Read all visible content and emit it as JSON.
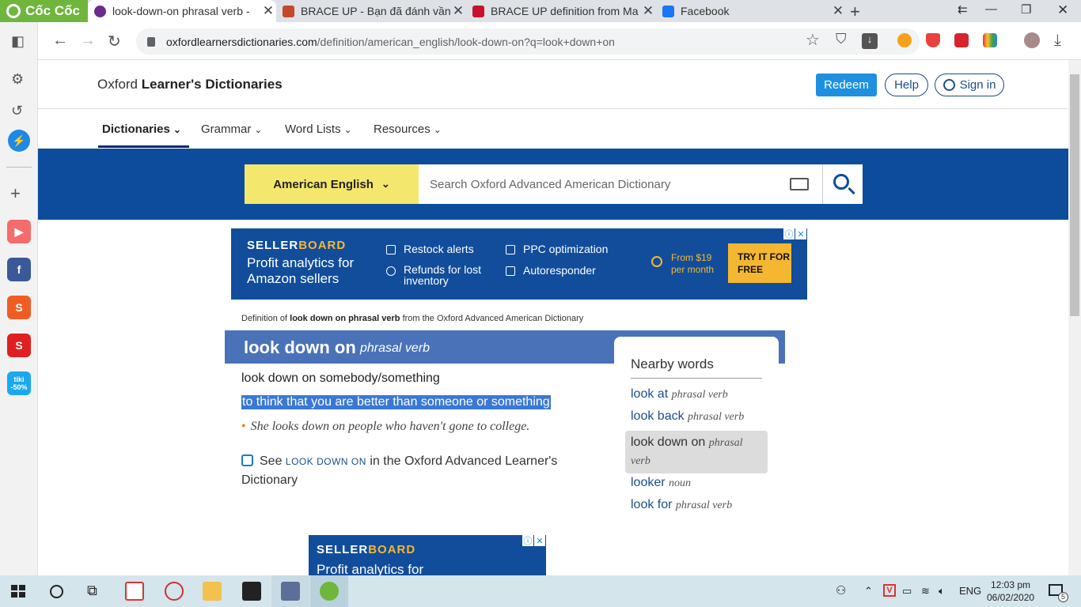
{
  "browser": {
    "brand": "Cốc Cốc",
    "tabs": [
      {
        "title": "look-down-on phrasal verb - ",
        "favicon_color": "#6a2b8c",
        "active": true
      },
      {
        "title": "BRACE UP - Bạn đã đánh vần",
        "favicon_color": "#c24a2a",
        "active": false
      },
      {
        "title": "BRACE UP definition from Ma",
        "favicon_color": "#c8102e",
        "active": false
      },
      {
        "title": "Facebook",
        "favicon_color": "#1877f2",
        "active": false
      }
    ],
    "url_host": "oxfordlearnersdictionaries.com",
    "url_path": "/definition/american_english/look-down-on?q=look+down+on"
  },
  "header": {
    "logo_prefix": "Oxford ",
    "logo_bold": "Learner's Dictionaries",
    "redeem": "Redeem",
    "help": "Help",
    "signin": "Sign in"
  },
  "nav": {
    "items": [
      "Dictionaries",
      "Grammar",
      "Word Lists",
      "Resources"
    ]
  },
  "search": {
    "dictionary": "American English",
    "placeholder": "Search Oxford Advanced American Dictionary"
  },
  "ad": {
    "brand_a": "SELLER",
    "brand_b": "BOARD",
    "tagline": "Profit analytics for Amazon sellers",
    "feature1": "Restock alerts",
    "feature2": "Refunds for lost inventory",
    "feature3": "PPC optimization",
    "feature4": "Autoresponder",
    "price": "From $19 per month",
    "cta": "TRY IT FOR FREE",
    "tagline_short": "Profit analytics for"
  },
  "entry": {
    "ref_prefix": "Definition of ",
    "ref_word": "look down on phrasal verb",
    "ref_suffix": " from the Oxford Advanced American Dictionary",
    "headword": "look down on",
    "pos": "phrasal verb",
    "sense_head": "look down on somebody/something",
    "definition": "to think that you are better than someone or something",
    "example": "She looks down on people who haven't gone to college.",
    "see_prefix": "See ",
    "see_link": "LOOK DOWN ON",
    "see_suffix": " in the Oxford Advanced Learner's Dictionary"
  },
  "nearby": {
    "title": "Nearby words",
    "items": [
      {
        "word": "look at",
        "pos": "phrasal verb"
      },
      {
        "word": "look back",
        "pos": "phrasal verb"
      },
      {
        "word": "look down on",
        "pos": "phrasal verb"
      },
      {
        "word": "looker",
        "pos": "noun"
      },
      {
        "word": "look for",
        "pos": "phrasal verb"
      }
    ]
  },
  "taskbar": {
    "lang": "ENG",
    "time": "12:03 pm",
    "date": "06/02/2020",
    "notifications": "5"
  }
}
